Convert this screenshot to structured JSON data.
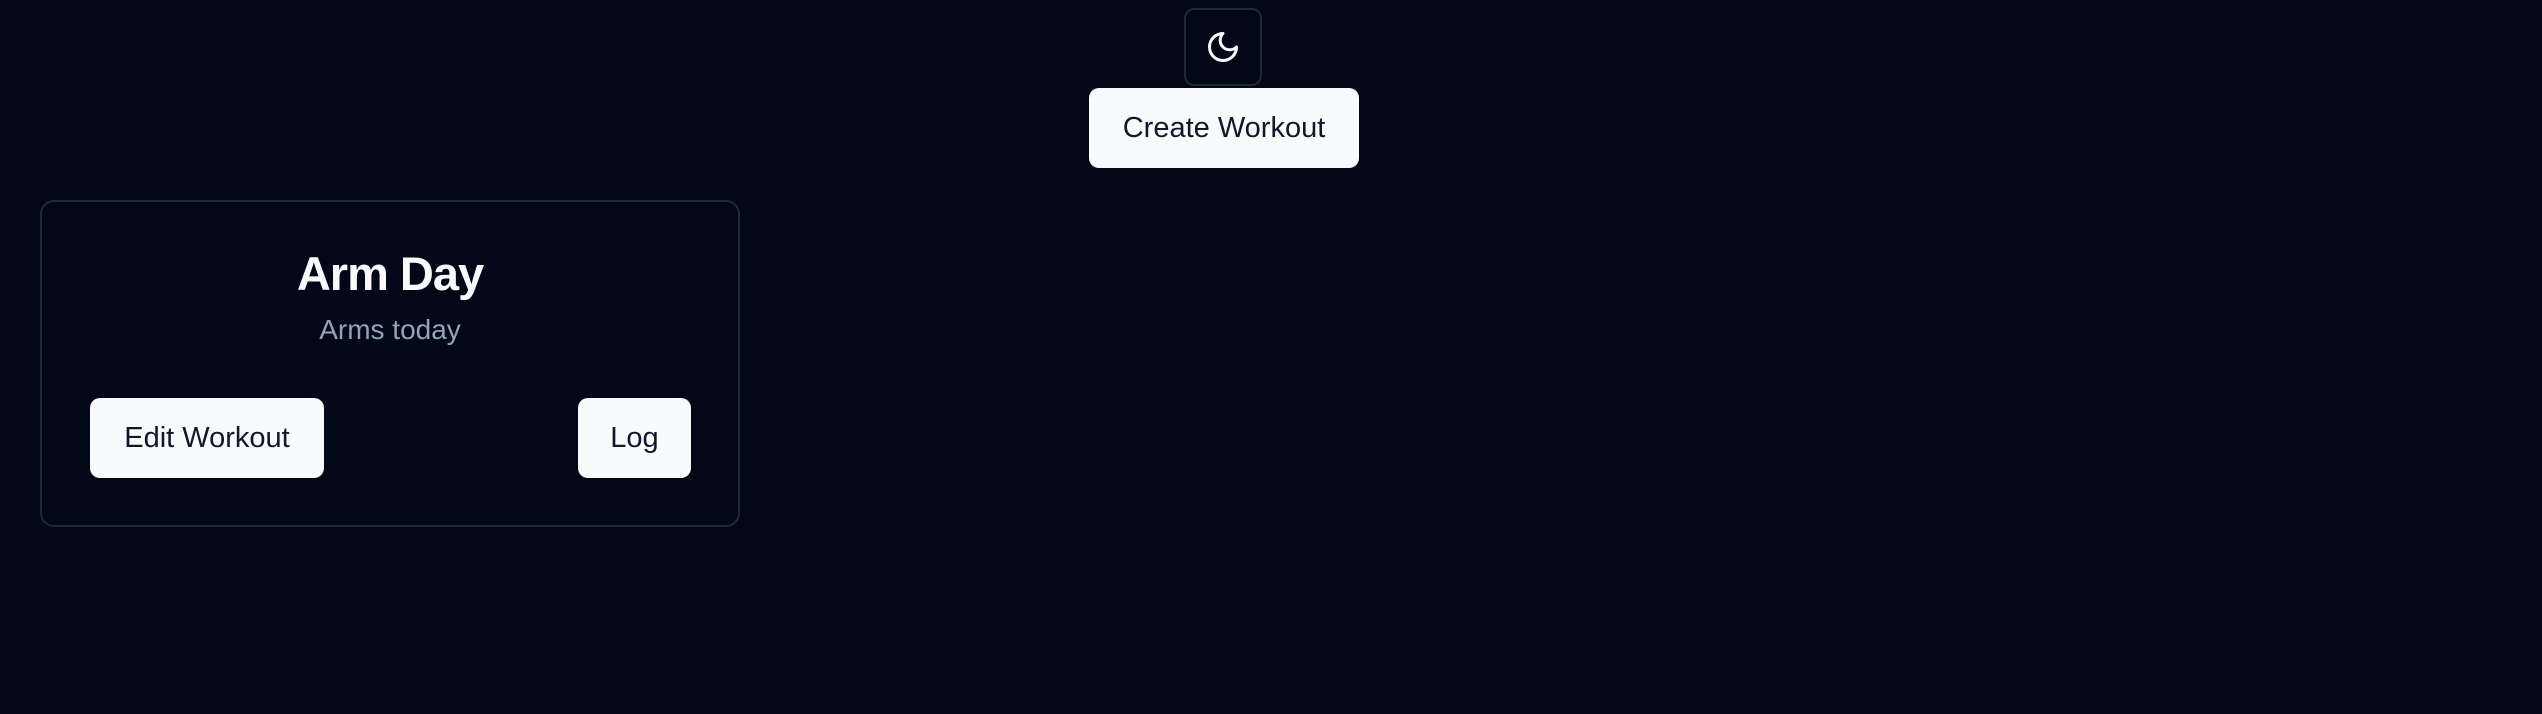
{
  "header": {
    "theme_toggle_icon": "moon-icon",
    "create_button_label": "Create Workout"
  },
  "workouts": [
    {
      "title": "Arm Day",
      "description": "Arms today",
      "edit_label": "Edit Workout",
      "log_label": "Log"
    }
  ],
  "colors": {
    "background": "#020817",
    "button_background": "#f8fafc",
    "button_text": "#0f172a",
    "muted_text": "#94a3b8",
    "border": "#1e293b"
  }
}
